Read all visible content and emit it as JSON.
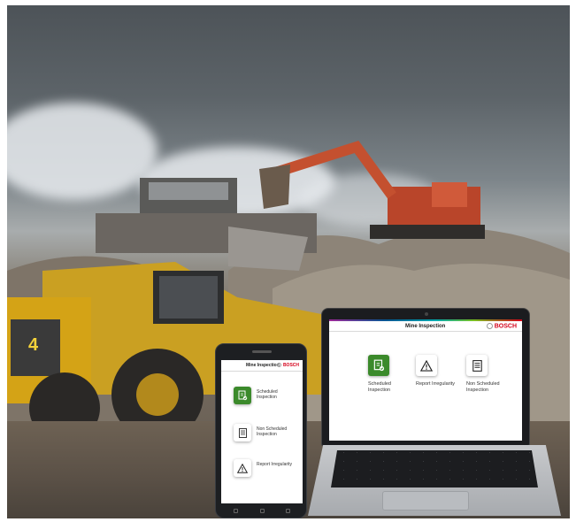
{
  "phone": {
    "header_title": "Mine Inspection",
    "brand": "BOSCH",
    "items": [
      {
        "label": "Scheduled Inspection",
        "icon": "checklist-check-icon",
        "accent": "#3b8a2b"
      },
      {
        "label": "Non Scheduled Inspection",
        "icon": "list-icon"
      },
      {
        "label": "Report Irregularity",
        "icon": "warning-icon"
      }
    ]
  },
  "laptop": {
    "header_title": "Mine Inspection",
    "brand": "BOSCH",
    "items": [
      {
        "label": "Scheduled Inspection",
        "icon": "checklist-check-icon",
        "accent": "#3b8a2b"
      },
      {
        "label": "Report Irregularity",
        "icon": "warning-icon"
      },
      {
        "label": "Non Scheduled Inspection",
        "icon": "list-icon"
      }
    ]
  },
  "colors": {
    "brand_red": "#d4001a",
    "accent_green": "#3b8a2b"
  },
  "scene": {
    "machine_number": "4"
  }
}
